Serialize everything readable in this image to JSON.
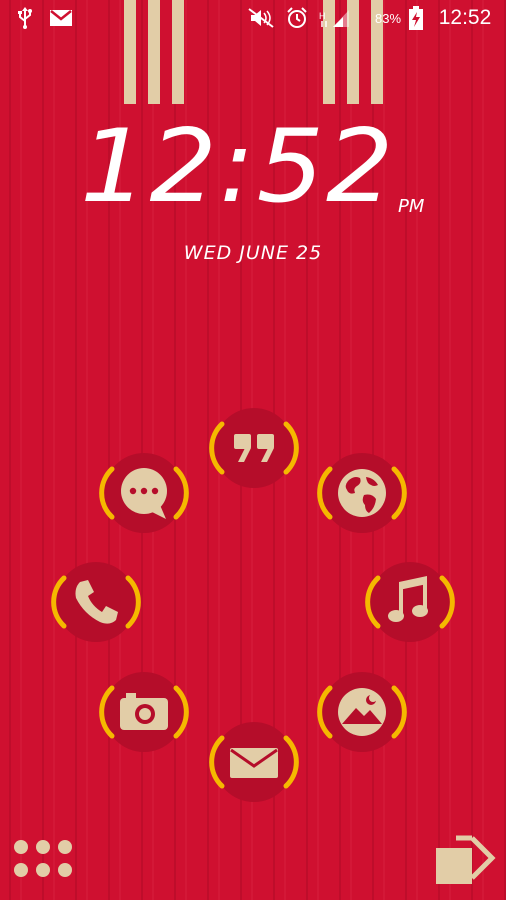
{
  "status_bar": {
    "icons_left": [
      "usb-icon",
      "gmail-icon"
    ],
    "icons_right": [
      "mute-icon",
      "alarm-icon",
      "signal-icon",
      "battery-icon"
    ],
    "battery_percent": "83%",
    "time": "12:52"
  },
  "clock": {
    "time": "12:52",
    "ampm": "PM",
    "date": "WED JUNE 25"
  },
  "apps": [
    {
      "name": "hangouts-app",
      "icon": "quote-icon"
    },
    {
      "name": "browser-app",
      "icon": "globe-icon"
    },
    {
      "name": "music-app",
      "icon": "music-note-icon"
    },
    {
      "name": "gallery-app",
      "icon": "landscape-icon"
    },
    {
      "name": "email-app",
      "icon": "envelope-icon"
    },
    {
      "name": "camera-app",
      "icon": "camera-icon"
    },
    {
      "name": "phone-app",
      "icon": "phone-icon"
    },
    {
      "name": "messaging-app",
      "icon": "chat-bubble-icon"
    }
  ],
  "colors": {
    "background": "#cf1030",
    "accent": "#f5b800",
    "beige": "#e2cda7",
    "circle": "#b50d2a"
  },
  "bottom_bar": {
    "left_icon": "app-drawer-icon",
    "right_icon": "unlock-arrow-icon"
  }
}
